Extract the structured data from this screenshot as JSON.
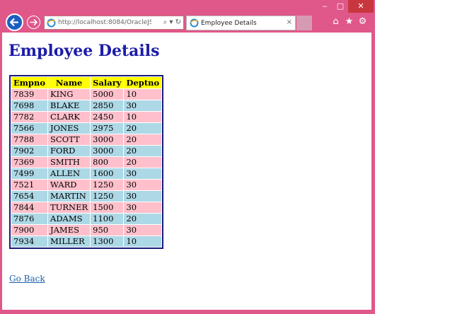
{
  "browser": {
    "address": "http://localhost:8084/OracleJSF/f",
    "tab_title": "Employee Details",
    "tab_close": "×",
    "window_controls": {
      "minimize": "‒",
      "maximize": "□",
      "close": "✕"
    },
    "address_icons": "⌕ ▾ ↻",
    "toolbar": {
      "home": "⌂",
      "favorites": "★",
      "settings": "⚙"
    }
  },
  "page": {
    "title": "Employee Details",
    "link_back": "Go Back"
  },
  "table": {
    "columns": [
      "Empno",
      "Name",
      "Salary",
      "Deptno"
    ],
    "rows": [
      [
        "7839",
        "KING",
        "5000",
        "10"
      ],
      [
        "7698",
        "BLAKE",
        "2850",
        "30"
      ],
      [
        "7782",
        "CLARK",
        "2450",
        "10"
      ],
      [
        "7566",
        "JONES",
        "2975",
        "20"
      ],
      [
        "7788",
        "SCOTT",
        "3000",
        "20"
      ],
      [
        "7902",
        "FORD",
        "3000",
        "20"
      ],
      [
        "7369",
        "SMITH",
        "800",
        "20"
      ],
      [
        "7499",
        "ALLEN",
        "1600",
        "30"
      ],
      [
        "7521",
        "WARD",
        "1250",
        "30"
      ],
      [
        "7654",
        "MARTIN",
        "1250",
        "30"
      ],
      [
        "7844",
        "TURNER",
        "1500",
        "30"
      ],
      [
        "7876",
        "ADAMS",
        "1100",
        "20"
      ],
      [
        "7900",
        "JAMES",
        "950",
        "30"
      ],
      [
        "7934",
        "MILLER",
        "1300",
        "10"
      ]
    ]
  },
  "colors": {
    "frame": "#e0578a",
    "title": "#1c1ca8",
    "header_bg": "#ffff00",
    "row_odd": "#ffc0cb",
    "row_even": "#add8e6",
    "table_border": "#1a1a7a",
    "link": "#1c5fa8"
  }
}
